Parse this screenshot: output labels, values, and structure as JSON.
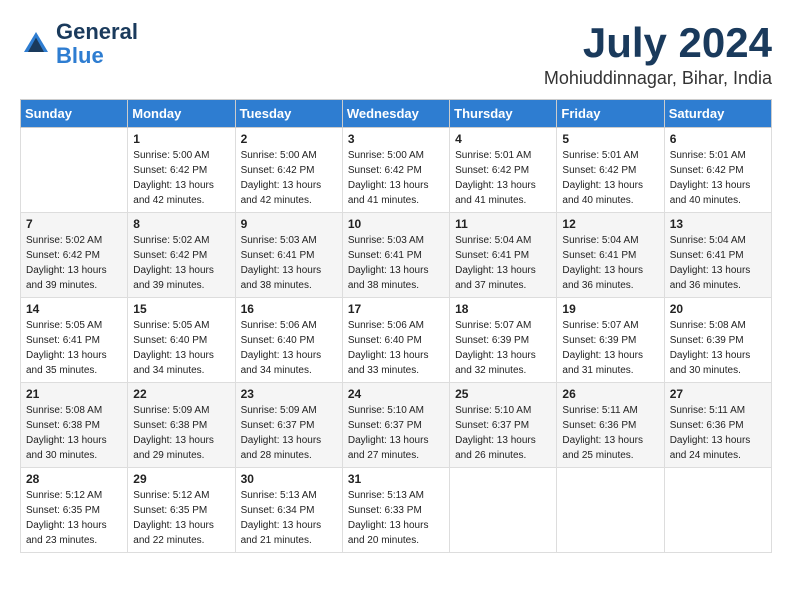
{
  "header": {
    "logo_line1": "General",
    "logo_line2": "Blue",
    "title": "July 2024",
    "subtitle": "Mohiuddinnagar, Bihar, India"
  },
  "calendar": {
    "days_of_week": [
      "Sunday",
      "Monday",
      "Tuesday",
      "Wednesday",
      "Thursday",
      "Friday",
      "Saturday"
    ],
    "weeks": [
      [
        {
          "num": "",
          "info": ""
        },
        {
          "num": "1",
          "info": "Sunrise: 5:00 AM\nSunset: 6:42 PM\nDaylight: 13 hours\nand 42 minutes."
        },
        {
          "num": "2",
          "info": "Sunrise: 5:00 AM\nSunset: 6:42 PM\nDaylight: 13 hours\nand 42 minutes."
        },
        {
          "num": "3",
          "info": "Sunrise: 5:00 AM\nSunset: 6:42 PM\nDaylight: 13 hours\nand 41 minutes."
        },
        {
          "num": "4",
          "info": "Sunrise: 5:01 AM\nSunset: 6:42 PM\nDaylight: 13 hours\nand 41 minutes."
        },
        {
          "num": "5",
          "info": "Sunrise: 5:01 AM\nSunset: 6:42 PM\nDaylight: 13 hours\nand 40 minutes."
        },
        {
          "num": "6",
          "info": "Sunrise: 5:01 AM\nSunset: 6:42 PM\nDaylight: 13 hours\nand 40 minutes."
        }
      ],
      [
        {
          "num": "7",
          "info": "Sunrise: 5:02 AM\nSunset: 6:42 PM\nDaylight: 13 hours\nand 39 minutes."
        },
        {
          "num": "8",
          "info": "Sunrise: 5:02 AM\nSunset: 6:42 PM\nDaylight: 13 hours\nand 39 minutes."
        },
        {
          "num": "9",
          "info": "Sunrise: 5:03 AM\nSunset: 6:41 PM\nDaylight: 13 hours\nand 38 minutes."
        },
        {
          "num": "10",
          "info": "Sunrise: 5:03 AM\nSunset: 6:41 PM\nDaylight: 13 hours\nand 38 minutes."
        },
        {
          "num": "11",
          "info": "Sunrise: 5:04 AM\nSunset: 6:41 PM\nDaylight: 13 hours\nand 37 minutes."
        },
        {
          "num": "12",
          "info": "Sunrise: 5:04 AM\nSunset: 6:41 PM\nDaylight: 13 hours\nand 36 minutes."
        },
        {
          "num": "13",
          "info": "Sunrise: 5:04 AM\nSunset: 6:41 PM\nDaylight: 13 hours\nand 36 minutes."
        }
      ],
      [
        {
          "num": "14",
          "info": "Sunrise: 5:05 AM\nSunset: 6:41 PM\nDaylight: 13 hours\nand 35 minutes."
        },
        {
          "num": "15",
          "info": "Sunrise: 5:05 AM\nSunset: 6:40 PM\nDaylight: 13 hours\nand 34 minutes."
        },
        {
          "num": "16",
          "info": "Sunrise: 5:06 AM\nSunset: 6:40 PM\nDaylight: 13 hours\nand 34 minutes."
        },
        {
          "num": "17",
          "info": "Sunrise: 5:06 AM\nSunset: 6:40 PM\nDaylight: 13 hours\nand 33 minutes."
        },
        {
          "num": "18",
          "info": "Sunrise: 5:07 AM\nSunset: 6:39 PM\nDaylight: 13 hours\nand 32 minutes."
        },
        {
          "num": "19",
          "info": "Sunrise: 5:07 AM\nSunset: 6:39 PM\nDaylight: 13 hours\nand 31 minutes."
        },
        {
          "num": "20",
          "info": "Sunrise: 5:08 AM\nSunset: 6:39 PM\nDaylight: 13 hours\nand 30 minutes."
        }
      ],
      [
        {
          "num": "21",
          "info": "Sunrise: 5:08 AM\nSunset: 6:38 PM\nDaylight: 13 hours\nand 30 minutes."
        },
        {
          "num": "22",
          "info": "Sunrise: 5:09 AM\nSunset: 6:38 PM\nDaylight: 13 hours\nand 29 minutes."
        },
        {
          "num": "23",
          "info": "Sunrise: 5:09 AM\nSunset: 6:37 PM\nDaylight: 13 hours\nand 28 minutes."
        },
        {
          "num": "24",
          "info": "Sunrise: 5:10 AM\nSunset: 6:37 PM\nDaylight: 13 hours\nand 27 minutes."
        },
        {
          "num": "25",
          "info": "Sunrise: 5:10 AM\nSunset: 6:37 PM\nDaylight: 13 hours\nand 26 minutes."
        },
        {
          "num": "26",
          "info": "Sunrise: 5:11 AM\nSunset: 6:36 PM\nDaylight: 13 hours\nand 25 minutes."
        },
        {
          "num": "27",
          "info": "Sunrise: 5:11 AM\nSunset: 6:36 PM\nDaylight: 13 hours\nand 24 minutes."
        }
      ],
      [
        {
          "num": "28",
          "info": "Sunrise: 5:12 AM\nSunset: 6:35 PM\nDaylight: 13 hours\nand 23 minutes."
        },
        {
          "num": "29",
          "info": "Sunrise: 5:12 AM\nSunset: 6:35 PM\nDaylight: 13 hours\nand 22 minutes."
        },
        {
          "num": "30",
          "info": "Sunrise: 5:13 AM\nSunset: 6:34 PM\nDaylight: 13 hours\nand 21 minutes."
        },
        {
          "num": "31",
          "info": "Sunrise: 5:13 AM\nSunset: 6:33 PM\nDaylight: 13 hours\nand 20 minutes."
        },
        {
          "num": "",
          "info": ""
        },
        {
          "num": "",
          "info": ""
        },
        {
          "num": "",
          "info": ""
        }
      ]
    ]
  }
}
